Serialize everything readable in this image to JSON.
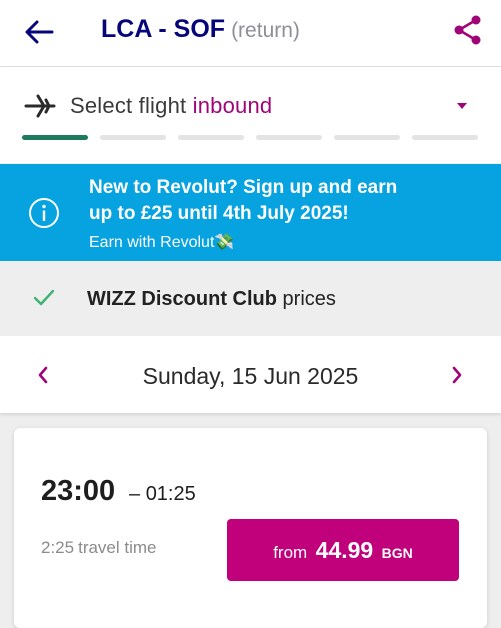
{
  "colors": {
    "brand_navy": "#06067a",
    "brand_magenta": "#c1007b",
    "banner_blue": "#06a3e0",
    "progress_green": "#1d7a5e"
  },
  "header": {
    "route": "LCA - SOF",
    "route_suffix": "(return)",
    "back_icon": "arrow-left-icon",
    "share_icon": "share-icon"
  },
  "flight_select": {
    "icon": "plane-icon",
    "label": "Select flight",
    "direction": "inbound",
    "dropdown_icon": "caret-down-icon",
    "steps_total": 6,
    "steps_active": 1
  },
  "promo_banner": {
    "icon": "info-icon",
    "line1": "New to Revolut? Sign up and earn",
    "line2": "up to £25 until 4th July 2025!",
    "link": "Earn with Revolut💸"
  },
  "discount_club": {
    "icon": "check-icon",
    "bold": "WIZZ Discount Club",
    "rest": "prices"
  },
  "date_nav": {
    "prev_icon": "chevron-left-icon",
    "next_icon": "chevron-right-icon",
    "date": "Sunday, 15 Jun 2025"
  },
  "flights": [
    {
      "departure": "23:00",
      "separator": "–",
      "arrival": "01:25",
      "duration": "2:25",
      "duration_label": "travel time",
      "price_prefix": "from",
      "price": "44.99",
      "currency": "BGN"
    }
  ]
}
